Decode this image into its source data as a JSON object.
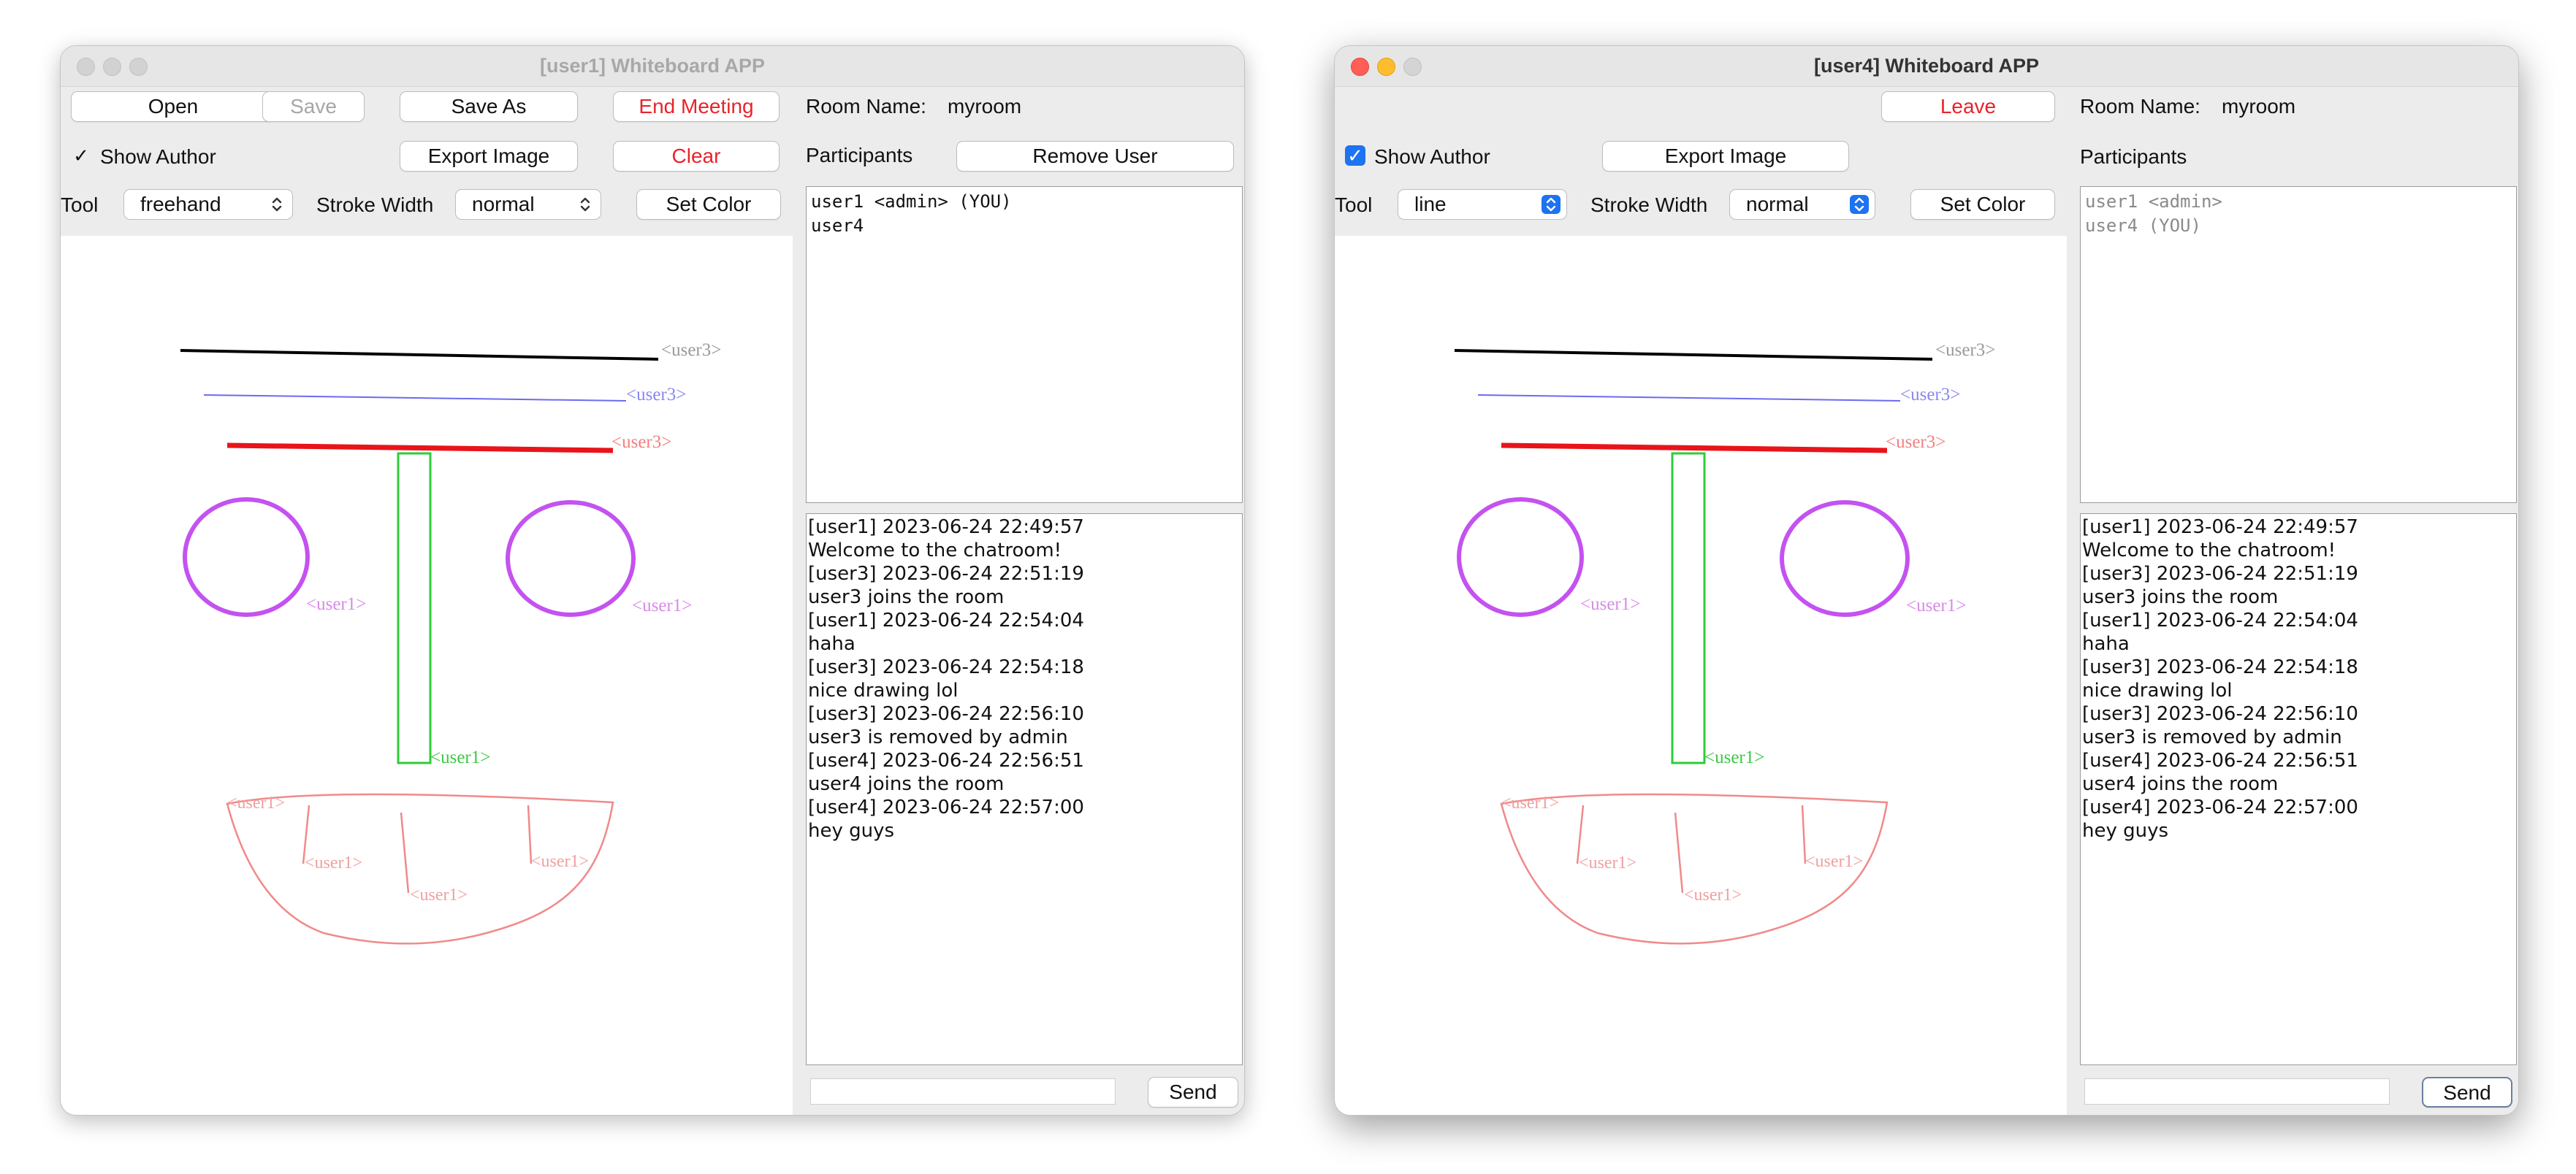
{
  "windows": [
    {
      "title": "[user1] Whiteboard APP",
      "buttons": {
        "open": "Open",
        "save": "Save",
        "save_as": "Save As",
        "end_meeting": "End Meeting",
        "export_image": "Export Image",
        "clear": "Clear",
        "remove_user": "Remove User",
        "set_color": "Set Color",
        "send": "Send"
      },
      "room_label": "Room Name:",
      "room_name": "myroom",
      "participants_label": "Participants",
      "show_author_label": "Show Author",
      "show_author_checked": true,
      "tool_label": "Tool",
      "tool_value": "freehand",
      "stroke_label": "Stroke Width",
      "stroke_value": "normal",
      "participants": [
        "user1 <admin> (YOU)",
        "user4"
      ],
      "chat_input": ""
    },
    {
      "title": "[user4] Whiteboard APP",
      "buttons": {
        "leave": "Leave",
        "export_image": "Export Image",
        "set_color": "Set Color",
        "send": "Send"
      },
      "room_label": "Room Name:",
      "room_name": "myroom",
      "participants_label": "Participants",
      "show_author_label": "Show Author",
      "show_author_checked": true,
      "tool_label": "Tool",
      "tool_value": "line",
      "stroke_label": "Stroke Width",
      "stroke_value": "normal",
      "participants": [
        "user1 <admin>",
        "user4 (YOU)"
      ],
      "chat_input": ""
    }
  ],
  "chat_messages": [
    "[user1] 2023-06-24 22:49:57",
    "Welcome to the chatroom!",
    "[user3] 2023-06-24 22:51:19",
    "user3 joins the room",
    "[user1] 2023-06-24 22:54:04",
    "haha",
    "[user3] 2023-06-24 22:54:18",
    "nice drawing lol",
    "[user3] 2023-06-24 22:56:10",
    "user3 is removed by admin",
    "[user4] 2023-06-24 22:56:51",
    "user4 joins the room",
    "[user4] 2023-06-24 22:57:00",
    "hey guys"
  ],
  "drawing": {
    "author_labels": {
      "black_line": "<user3>",
      "blue_line": "<user3>",
      "red_line": "<user3>",
      "left_eye": "<user1>",
      "right_eye": "<user1>",
      "nose": "<user1>",
      "mouth_left": "<user1>",
      "mouth_tooth_1": "<user1>",
      "mouth_tooth_2": "<user1>",
      "mouth_tooth_3": "<user1>"
    },
    "colors": {
      "black_line": "#000000",
      "blue_line": "#6b6bf0",
      "red_line": "#e8141a",
      "eyes": "#c452f0",
      "nose": "#2ecc3a",
      "mouth": "#f08a8a",
      "label_black": "#999999",
      "label_blue": "#8888ee",
      "label_red": "#f08080",
      "label_eyes": "#d88ae8",
      "label_nose": "#3cc845",
      "label_mouth": "#f0a0a0"
    }
  },
  "icons": {
    "checkbox": "checkmark-icon",
    "combo_arrow": "chevron-up-down-icon"
  }
}
